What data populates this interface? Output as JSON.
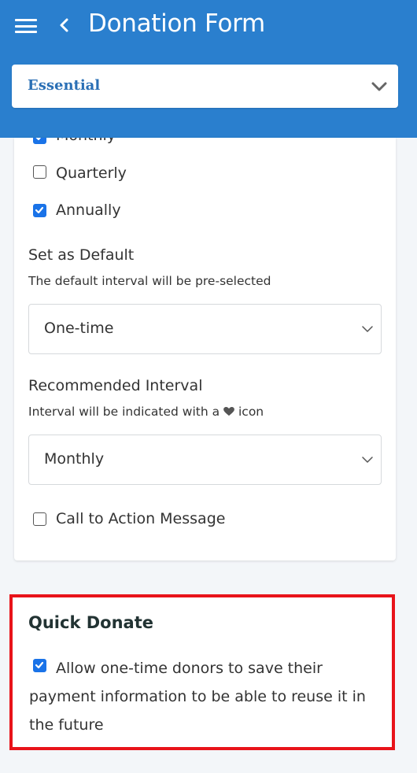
{
  "header": {
    "title": "Donation Form",
    "menu_icon": "hamburger-menu-icon",
    "back_icon": "chevron-left-icon",
    "background_color": "#2a7fce"
  },
  "plan_select": {
    "selected": "Essential",
    "icon": "chevron-down-icon"
  },
  "intervals": {
    "partial_label": "Monthly",
    "monthly_checked": true,
    "quarterly_label": "Quarterly",
    "quarterly_checked": false,
    "annually_label": "Annually",
    "annually_checked": true
  },
  "default_interval": {
    "label": "Set as Default",
    "helper": "The default interval will be pre-selected",
    "selected": "One-time"
  },
  "recommended_interval": {
    "label": "Recommended Interval",
    "helper_prefix": "Interval will be indicated with a",
    "helper_icon": "heart-icon",
    "helper_suffix": "icon",
    "selected": "Monthly"
  },
  "call_to_action": {
    "label": "Call to Action Message",
    "checked": false
  },
  "quick_donate": {
    "title": "Quick Donate",
    "label": "Allow one-time donors to save their payment information to be able to reuse it in the future",
    "checked": true,
    "highlight_color": "#e8131a"
  },
  "colors": {
    "checkbox_checked": "#1a73e8"
  }
}
